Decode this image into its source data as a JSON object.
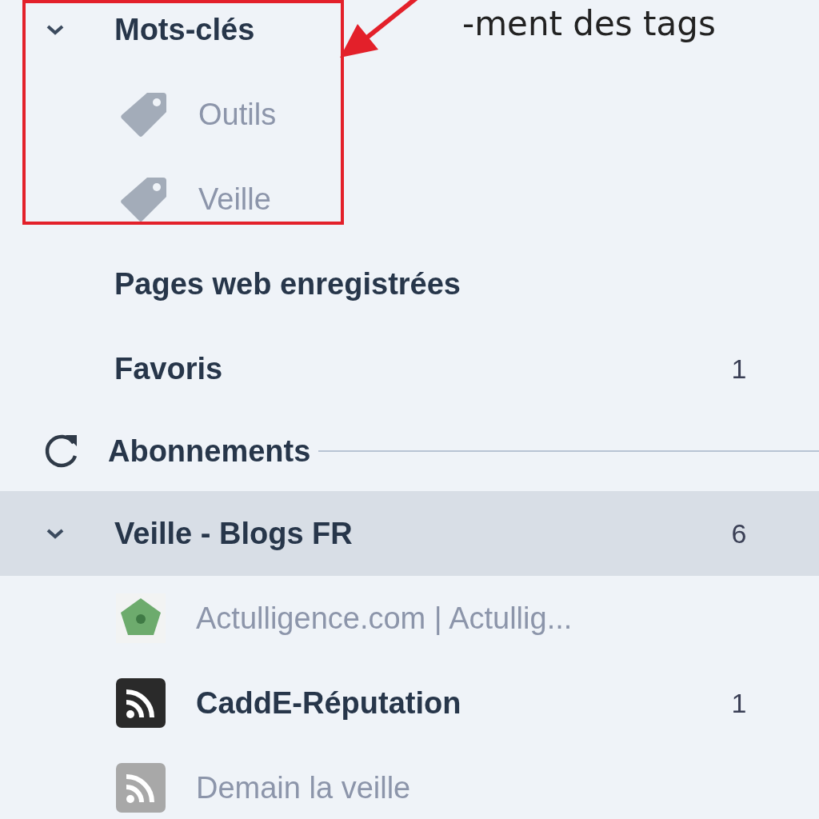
{
  "annotation": {
    "text": "-ment des tags"
  },
  "tags_section": {
    "title": "Mots-clés",
    "expanded": true,
    "items": [
      {
        "label": "Outils"
      },
      {
        "label": "Veille"
      }
    ]
  },
  "links": [
    {
      "label": "Pages web enregistrées"
    },
    {
      "label": "Favoris",
      "count": "1"
    }
  ],
  "subscriptions": {
    "title": "Abonnements"
  },
  "folders": [
    {
      "title": "Veille - Blogs FR",
      "count": "6",
      "expanded": true,
      "selected": true,
      "feeds": [
        {
          "label": "Actulligence.com | Actullig...",
          "unread": false,
          "kind": "favicon"
        },
        {
          "label": "CaddE-Réputation",
          "count": "1",
          "unread": true,
          "kind": "rss"
        },
        {
          "label": "Demain la veille",
          "unread": false,
          "kind": "rss"
        }
      ]
    }
  ]
}
